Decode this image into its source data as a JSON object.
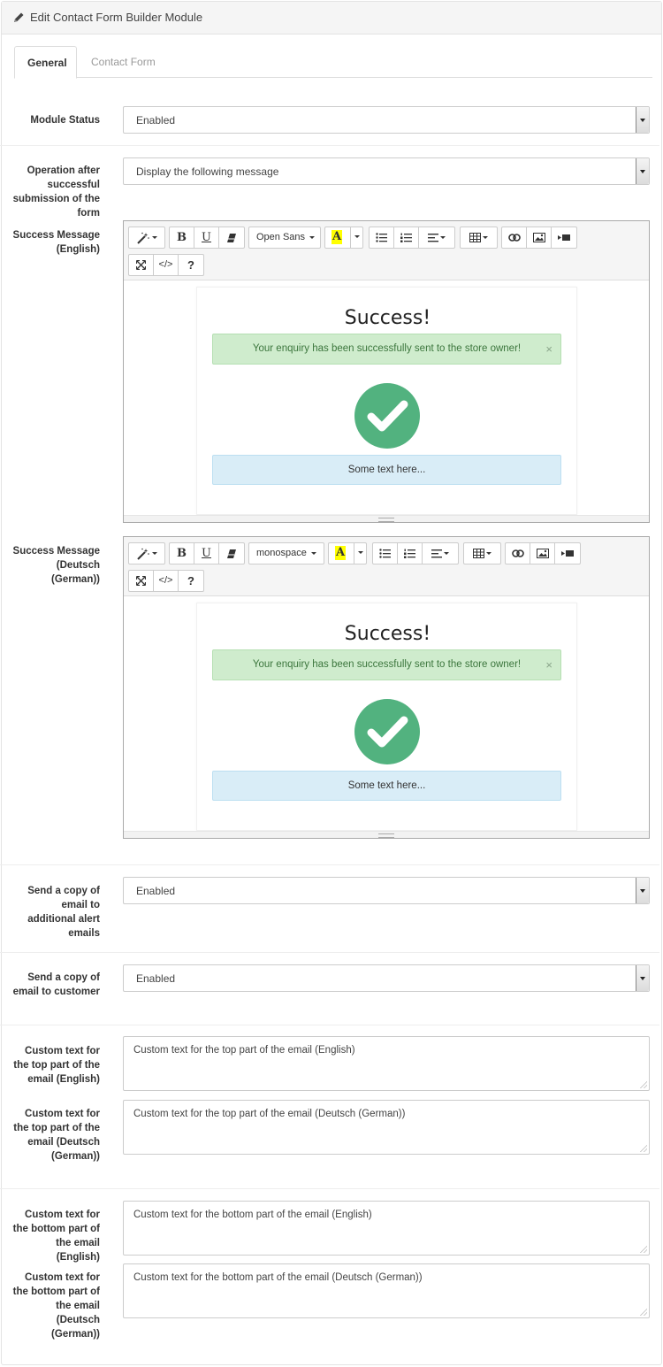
{
  "header": {
    "title": "Edit Contact Form Builder Module"
  },
  "tabs": [
    {
      "label": "General"
    },
    {
      "label": "Contact Form"
    }
  ],
  "module_status": {
    "label": "Module Status",
    "value": "Enabled"
  },
  "operation": {
    "label": "Operation after successful submission of the form",
    "value": "Display the following message"
  },
  "editors": [
    {
      "label": "Success Message (English)",
      "font": "Open Sans",
      "heading": "Success!",
      "alert": "Your enquiry has been successfully sent to the store owner!",
      "info": "Some text here...",
      "close": "×"
    },
    {
      "label": "Success Message (Deutsch (German))",
      "font": "monospace",
      "heading": "Success!",
      "alert": "Your enquiry has been successfully sent to the store owner!",
      "info": "Some text here...",
      "close": "×"
    }
  ],
  "toolbar": {
    "bold": "B",
    "underline": "U",
    "color": "A",
    "codeview": "</>",
    "help": "?"
  },
  "alert_copy": {
    "label": "Send a copy of email to additional alert emails",
    "value": "Enabled"
  },
  "customer_copy": {
    "label": "Send a copy of email to customer",
    "value": "Enabled"
  },
  "top_text": [
    {
      "label": "Custom text for the top part of the email (English)",
      "placeholder": "Custom text for the top part of the email (English)"
    },
    {
      "label": "Custom text for the top part of the email (Deutsch (German))",
      "placeholder": "Custom text for the top part of the email (Deutsch (German))"
    }
  ],
  "bottom_text": [
    {
      "label": "Custom text for the bottom part of the email (English)",
      "placeholder": "Custom text for the bottom part of the email (English)"
    },
    {
      "label": "Custom text for the bottom part of the email (Deutsch (German))",
      "placeholder": "Custom text for the bottom part of the email (Deutsch (German))"
    }
  ],
  "colors": {
    "check_green": "#52b27f",
    "alert_success_bg": "#cfeccd",
    "alert_info_bg": "#d9edf7"
  }
}
